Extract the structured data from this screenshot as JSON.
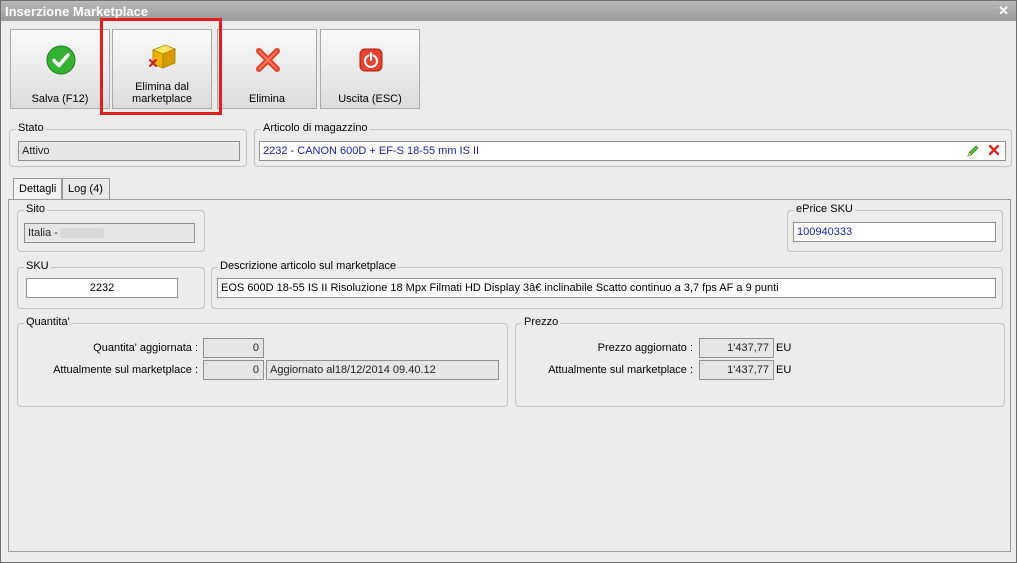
{
  "window": {
    "title": "Inserzione Marketplace"
  },
  "toolbar": {
    "save_label": "Salva (F12)",
    "remove_marketplace_label": "Elimina dal\nmarketplace",
    "delete_label": "Elimina",
    "exit_label": "Uscita (ESC)"
  },
  "stato": {
    "legend": "Stato",
    "value": "Attivo"
  },
  "articolo": {
    "legend": "Articolo di magazzino",
    "value": "2232 - CANON 600D + EF-S 18-55 mm IS II"
  },
  "tabs": [
    {
      "label": "Dettagli"
    },
    {
      "label": "Log (4)"
    }
  ],
  "sito": {
    "legend": "Sito",
    "value": "Italia -"
  },
  "eprice": {
    "legend": "ePrice SKU",
    "value": "100940333"
  },
  "sku": {
    "legend": "SKU",
    "value": "2232"
  },
  "descrizione": {
    "legend": "Descrizione articolo sul marketplace",
    "value": "EOS 600D 18-55 IS II Risoluzione 18 Mpx Filmati HD Display 3â€ inclinabile Scatto continuo a 3,7 fps AF a 9 punti"
  },
  "quantita": {
    "legend": "Quantita'",
    "aggiornata_label": "Quantita' aggiornata :",
    "aggiornata_value": "0",
    "attuale_label": "Attualmente sul marketplace :",
    "attuale_value": "0",
    "aggiornato_text": "Aggiornato al18/12/2014 09.40.12"
  },
  "prezzo": {
    "legend": "Prezzo",
    "aggiornato_label": "Prezzo aggiornato :",
    "aggiornato_value": "1'437,77",
    "attuale_label": "Attualmente sul marketplace :",
    "attuale_value": "1'437,77",
    "currency": "EU"
  },
  "colors": {
    "highlight": "#e01e1e",
    "link_blue": "#1a1aa8"
  },
  "icons": [
    "checkmark-icon",
    "box-remove-icon",
    "delete-x-icon",
    "exit-power-icon",
    "edit-pencil-icon",
    "clear-x-icon",
    "close-icon"
  ]
}
